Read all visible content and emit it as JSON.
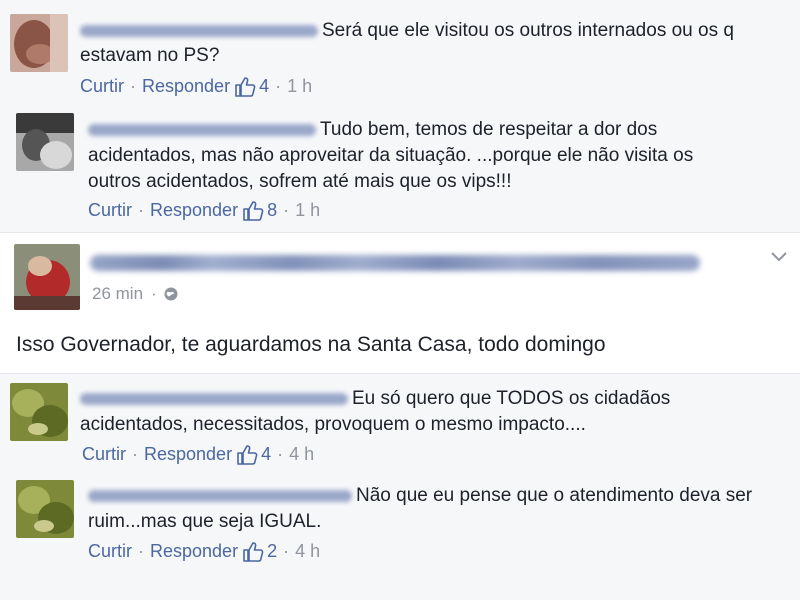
{
  "comments": [
    {
      "text_line1": "Será que ele visitou os outros internados ou os q",
      "text_line2": "estavam no PS?",
      "like_label": "Curtir",
      "reply_label": "Responder",
      "like_count": "4",
      "time": "1 h"
    },
    {
      "text_line1": "Tudo bem, temos de respeitar a dor dos",
      "text_line2": "acidentados, mas não aproveitar da situação. ...porque ele não visita os",
      "text_line3": "outros acidentados, sofrem até mais que os vips!!!",
      "like_label": "Curtir",
      "reply_label": "Responder",
      "like_count": "8",
      "time": "1 h"
    }
  ],
  "post": {
    "time": "26 min",
    "text": "Isso Governador, te aguardamos na Santa Casa, todo domingo"
  },
  "post_comments": [
    {
      "text_line1": "Eu só quero que TODOS os cidadãos",
      "text_line2": "acidentados, necessitados, provoquem o mesmo impacto....",
      "like_label": "Curtir",
      "reply_label": "Responder",
      "like_count": "4",
      "time": "4 h"
    },
    {
      "text_line1": "Não que eu pense que o atendimento deva ser",
      "text_line2": "ruim...mas que seja IGUAL.",
      "like_label": "Curtir",
      "reply_label": "Responder",
      "like_count": "2",
      "time": "4 h"
    }
  ],
  "icons": {
    "like": "thumbs-up-icon",
    "globe": "globe-icon",
    "menu": "chevron-down-icon"
  },
  "colors": {
    "link": "#4b67a1",
    "meta": "#90949c",
    "text": "#1d2129",
    "background": "#f6f7f9"
  }
}
